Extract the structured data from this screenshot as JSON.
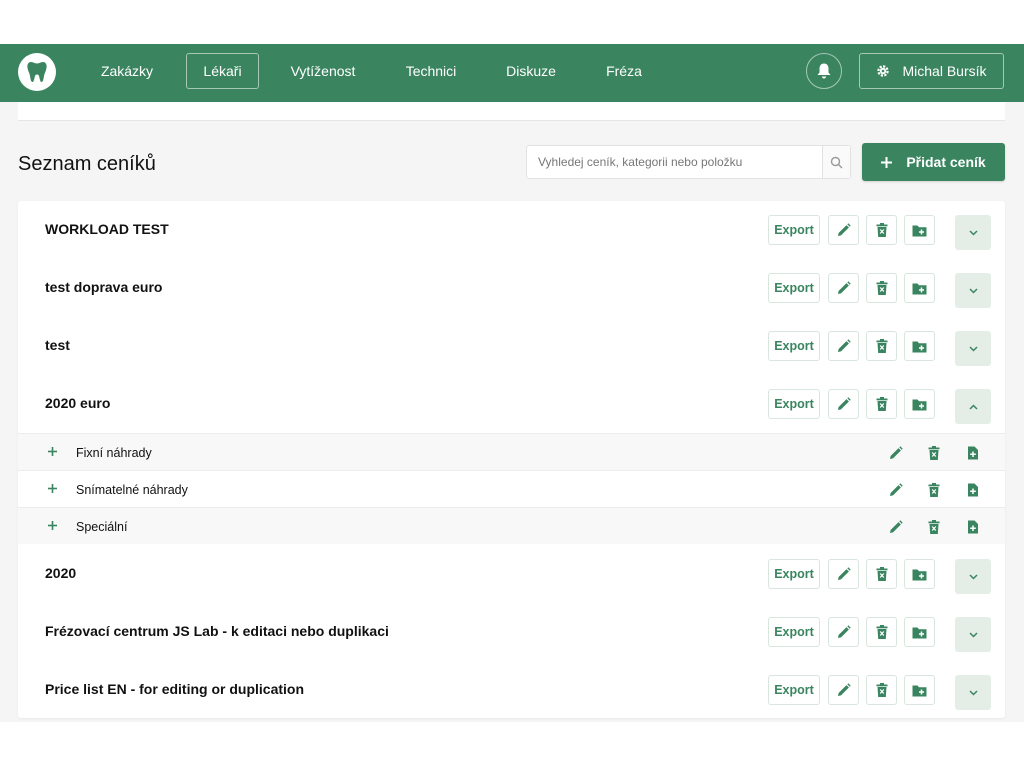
{
  "nav": {
    "items": [
      {
        "label": "Zakázky",
        "active": false
      },
      {
        "label": "Lékaři",
        "active": true
      },
      {
        "label": "Vytíženost",
        "active": false
      },
      {
        "label": "Technici",
        "active": false
      },
      {
        "label": "Diskuze",
        "active": false
      },
      {
        "label": "Fréza",
        "active": false
      }
    ],
    "user_name": "Michal Bursík"
  },
  "header": {
    "title": "Seznam ceníků",
    "search_placeholder": "Vyhledej ceník, kategorii nebo položku",
    "add_button_label": "Přidat ceník"
  },
  "pricelists": [
    {
      "name": "WORKLOAD TEST",
      "export_label": "Export",
      "expanded": false
    },
    {
      "name": "test doprava euro",
      "export_label": "Export",
      "expanded": false
    },
    {
      "name": "test",
      "export_label": "Export",
      "expanded": false
    },
    {
      "name": "2020 euro",
      "export_label": "Export",
      "expanded": true,
      "categories": [
        {
          "name": "Fixní náhrady"
        },
        {
          "name": "Snímatelné náhrady"
        },
        {
          "name": "Speciální"
        }
      ]
    },
    {
      "name": "2020",
      "export_label": "Export",
      "expanded": false
    },
    {
      "name": "Frézovací centrum JS Lab - k editaci nebo duplikaci",
      "export_label": "Export",
      "expanded": false
    },
    {
      "name": "Price list EN - for editing or duplication",
      "export_label": "Export",
      "expanded": false
    }
  ],
  "colors": {
    "brand": "#3a8560",
    "button_border": "#d8e6dd",
    "toggle_bg": "#e4eee7",
    "page_bg": "#f4f5f4"
  },
  "icons": {
    "logo": "tooth-icon",
    "bell": "bell-icon",
    "user": "gear-icon",
    "search": "search-icon",
    "add": "plus-icon",
    "edit": "pencil-icon",
    "delete": "trash-icon",
    "add_category": "folder-plus-icon",
    "add_item": "file-plus-icon",
    "expand": "chevron-down-icon",
    "collapse": "chevron-up-icon"
  }
}
